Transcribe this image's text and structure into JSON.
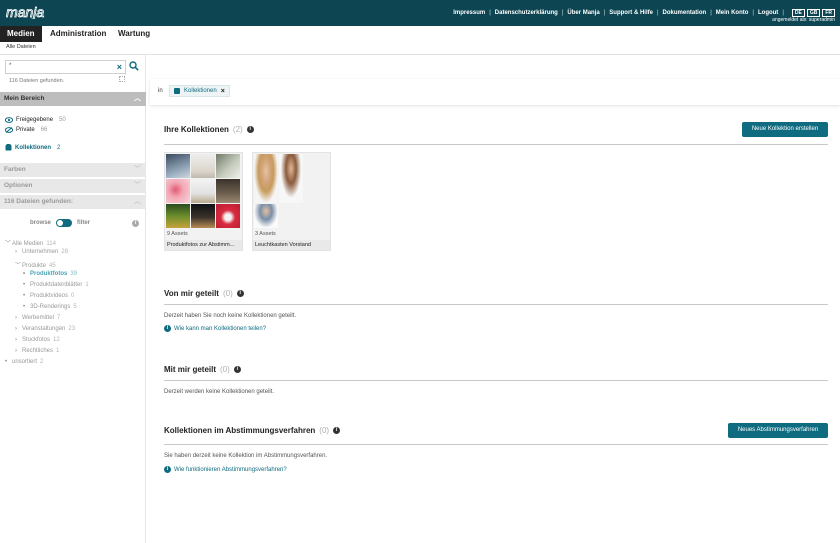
{
  "brand": {
    "logo": "manja"
  },
  "topnav": {
    "links": [
      "Impressum",
      "Datenschutzerklärung",
      "Über Manja",
      "Support & Hilfe",
      "Dokumentation",
      "Mein Konto",
      "Logout"
    ],
    "languages": [
      "DE",
      "GB",
      "FR"
    ],
    "logged_in": "angemeldet als: superadmin"
  },
  "mainnav": {
    "tabs": [
      "Medien",
      "Administration",
      "Wartung"
    ],
    "active": "Medien"
  },
  "subnav": {
    "label": "Alle Dateien"
  },
  "sidebar": {
    "search": {
      "value": "*"
    },
    "found_text": "116 Dateien gefunden.",
    "sections": {
      "mein_bereich": "Mein Bereich",
      "farben": "Farben",
      "optionen": "Optionen",
      "dateien": "116 Dateien gefunden:"
    },
    "mein_bereich_items": [
      {
        "label": "Freigegebene",
        "count": "50"
      },
      {
        "label": "Private",
        "count": "66"
      }
    ],
    "kollektionen": {
      "label": "Kollektionen",
      "count": "2"
    },
    "toggle": {
      "left": "browse",
      "right": "filter"
    },
    "tree": [
      {
        "label": "Alle Medien",
        "count": "114"
      },
      {
        "label": "Unternehmen",
        "count": "28"
      },
      {
        "label": "Produkte",
        "count": "45"
      },
      {
        "label": "Produktfotos",
        "count": "39"
      },
      {
        "label": "Produktdatenblätter",
        "count": "1"
      },
      {
        "label": "Produktvideos",
        "count": "0"
      },
      {
        "label": "3D-Renderings",
        "count": "5"
      },
      {
        "label": "Werbemittel",
        "count": "7"
      },
      {
        "label": "Veranstaltungen",
        "count": "23"
      },
      {
        "label": "Stockfotos",
        "count": "12"
      },
      {
        "label": "Rechtliches",
        "count": "1"
      },
      {
        "label": "unsortiert",
        "count": "2"
      }
    ]
  },
  "filterbar": {
    "in_label": "in",
    "chip": "Kollektionen"
  },
  "sections": {
    "ihre": {
      "title": "Ihre Kollektionen",
      "count": "(2)",
      "button": "Neue Kollektion erstellen"
    },
    "von_mir": {
      "title": "Von mir geteilt",
      "count": "(0)",
      "text": "Derzeit haben Sie noch keine Kollektionen geteilt.",
      "link": "Wie kann man Kollektionen teilen?"
    },
    "mit_mir": {
      "title": "Mit mir geteilt",
      "count": "(0)",
      "text": "Derzeit werden keine Kollektionen geteilt."
    },
    "abstimmung": {
      "title": "Kollektionen im Abstimmungsverfahren",
      "count": "(0)",
      "button": "Neues Abstimmungsverfahren",
      "text": "Sie haben derzeit keine Kollektion im Abstimmungsverfahren.",
      "link": "Wie funktionieren Abstimmungsverfahren?"
    }
  },
  "collections": [
    {
      "assets": "9 Assets",
      "name": "Produktfotos zur Abstimm..."
    },
    {
      "assets": "3 Assets",
      "name": "Leuchtkasten Vorstand"
    }
  ],
  "colors": {
    "brand": "#0d4552",
    "accent": "#0f6b80"
  }
}
